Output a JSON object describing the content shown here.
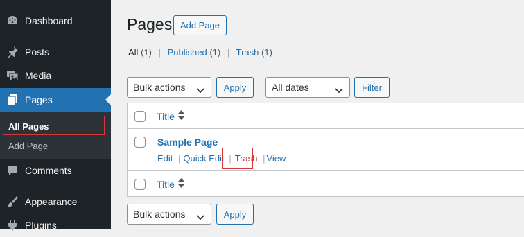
{
  "sidebar": {
    "items": [
      {
        "label": "Dashboard",
        "icon": "dashboard-icon"
      },
      {
        "label": "Posts",
        "icon": "pin-icon"
      },
      {
        "label": "Media",
        "icon": "media-icon"
      },
      {
        "label": "Pages",
        "icon": "pages-icon"
      },
      {
        "label": "Comments",
        "icon": "comment-icon"
      },
      {
        "label": "Appearance",
        "icon": "brush-icon"
      },
      {
        "label": "Plugins",
        "icon": "plugin-icon"
      }
    ],
    "submenu": [
      {
        "label": "All Pages"
      },
      {
        "label": "Add Page"
      }
    ]
  },
  "header": {
    "title": "Pages",
    "add_button": "Add Page"
  },
  "views": [
    {
      "label": "All",
      "count": "(1)"
    },
    {
      "label": "Published",
      "count": "(1)"
    },
    {
      "label": "Trash",
      "count": "(1)"
    }
  ],
  "filters": {
    "bulk_actions": "Bulk actions",
    "apply": "Apply",
    "dates": "All dates",
    "filter": "Filter"
  },
  "table": {
    "column_title": "Title",
    "rows": [
      {
        "title": "Sample Page",
        "actions": {
          "edit": "Edit",
          "quick_edit": "Quick Edit",
          "trash": "Trash",
          "view": "View"
        }
      }
    ]
  },
  "bottom": {
    "bulk_actions": "Bulk actions",
    "apply": "Apply"
  },
  "colors": {
    "sidebar_bg": "#1d2327",
    "accent": "#2271b1",
    "highlight": "#d63638"
  }
}
